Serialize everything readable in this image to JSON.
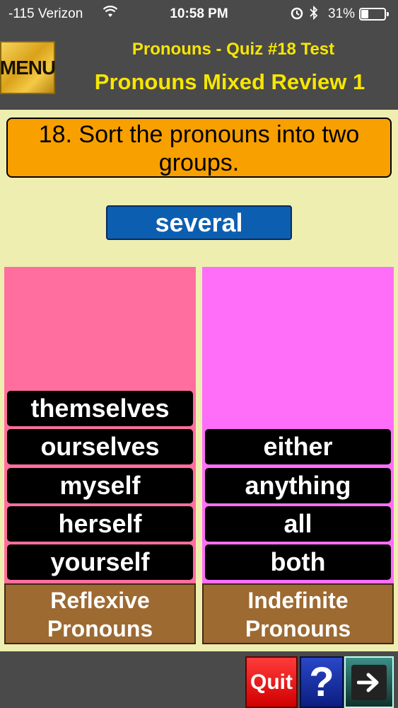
{
  "status_bar": {
    "carrier": "-115 Verizon",
    "time": "10:58 PM",
    "battery_percent": "31%",
    "battery_level": 0.31,
    "icons": [
      "wifi-icon",
      "alarm-icon",
      "bluetooth-icon",
      "battery-icon"
    ]
  },
  "header": {
    "menu_label": "MENU",
    "quiz_title": "Pronouns - Quiz #18 Test",
    "quiz_subtitle": "Pronouns Mixed Review 1"
  },
  "question": {
    "text": "18. Sort the pronouns into two groups."
  },
  "current_word": "several",
  "columns": {
    "left": {
      "category": "Reflexive Pronouns",
      "words": [
        "themselves",
        "ourselves",
        "myself",
        "herself",
        "yourself"
      ]
    },
    "right": {
      "category": "Indefinite Pronouns",
      "words": [
        "either",
        "anything",
        "all",
        "both"
      ]
    }
  },
  "footer": {
    "quit_label": "Quit",
    "help_label": "?",
    "next_icon": "arrow-right-icon"
  },
  "colors": {
    "background": "#eeeeb0",
    "header_text": "#f7e600",
    "question_bg": "#f8a000",
    "current_word_bg": "#0c5fb0",
    "left_column": "#ff6e9e",
    "right_column": "#ff6ef9",
    "category_bg": "#9d6a32"
  }
}
